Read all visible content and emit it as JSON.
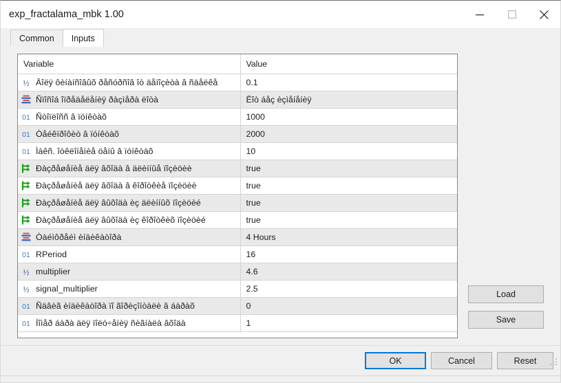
{
  "window": {
    "title": "exp_fractalama_mbk 1.00",
    "controls": [
      {
        "name": "minimize",
        "glyph": "minimize-icon"
      },
      {
        "name": "maximize",
        "glyph": "maximize-icon"
      },
      {
        "name": "close",
        "glyph": "close-icon"
      }
    ]
  },
  "tabs": [
    {
      "label": "Common",
      "active": false
    },
    {
      "label": "Inputs",
      "active": true
    }
  ],
  "grid": {
    "headers": [
      "Variable",
      "Value"
    ],
    "rows": [
      {
        "icon": "double-icon",
        "variable": "Äîëÿ ôèíàíñîâûõ ðåñóðñîâ îò äåïîçèòà â ñäåëêå",
        "value": "0.1"
      },
      {
        "icon": "enum-icon",
        "variable": "Ñïîñîá îïðåäåëåíèÿ ðàçìåðà ëîòà",
        "value": "Ëîò áåç èçìåíåíèÿ"
      },
      {
        "icon": "integer-icon",
        "variable": "Ñòîïëîññ â ïóíêòàõ",
        "value": "1000"
      },
      {
        "icon": "integer-icon",
        "variable": "Òåéêïðîôèò â ïóíêòàõ",
        "value": "2000"
      },
      {
        "icon": "integer-icon",
        "variable": "Ìàêñ. îòêëîíåíèå öåíû â ïóíêòàõ",
        "value": "10"
      },
      {
        "icon": "bool-icon",
        "variable": "Ðàçðåøåíèå äëÿ âõîäà â äëèííûå ïîçèöèè",
        "value": "true"
      },
      {
        "icon": "bool-icon",
        "variable": "Ðàçðåøåíèå äëÿ âõîäà â êîðîòêèå ïîçèöèè",
        "value": "true"
      },
      {
        "icon": "bool-icon",
        "variable": "Ðàçðåøåíèå äëÿ âûõîäà èç äëèííûõ ïîçèöèé",
        "value": "true"
      },
      {
        "icon": "bool-icon",
        "variable": "Ðàçðåøåíèå äëÿ âûõîäà èç êîðîòêèõ ïîçèöèé",
        "value": "true"
      },
      {
        "icon": "enum-icon",
        "variable": "Òàéìôðåéì èíäèêàòîðà",
        "value": "4 Hours"
      },
      {
        "icon": "integer-icon",
        "variable": "RPeriod",
        "value": "16"
      },
      {
        "icon": "double-icon",
        "variable": "multiplier",
        "value": "4.6"
      },
      {
        "icon": "double-icon",
        "variable": "signal_multiplier",
        "value": "2.5"
      },
      {
        "icon": "integer-icon",
        "variable": "Ñäâèã èíäèêàòîðà ïî ãîðèçîíòàëè â áàðàõ",
        "value": "0"
      },
      {
        "icon": "integer-icon",
        "variable": "Íîìåð áàðà äëÿ ïîëó÷åíèÿ ñèãíàëà âõîäà",
        "value": "1"
      }
    ]
  },
  "side_buttons": {
    "load": "Load",
    "save": "Save"
  },
  "footer_buttons": {
    "ok": "OK",
    "cancel": "Cancel",
    "reset": "Reset"
  },
  "colors": {
    "focus_border": "#0078d7",
    "icon_integer": "#3a7cc4",
    "icon_bool": "#14a014",
    "icon_enum_red": "#d4554a",
    "icon_enum_blue": "#3a6fc4",
    "row_alt": "#e9e9e9",
    "grid_border": "#828790"
  }
}
